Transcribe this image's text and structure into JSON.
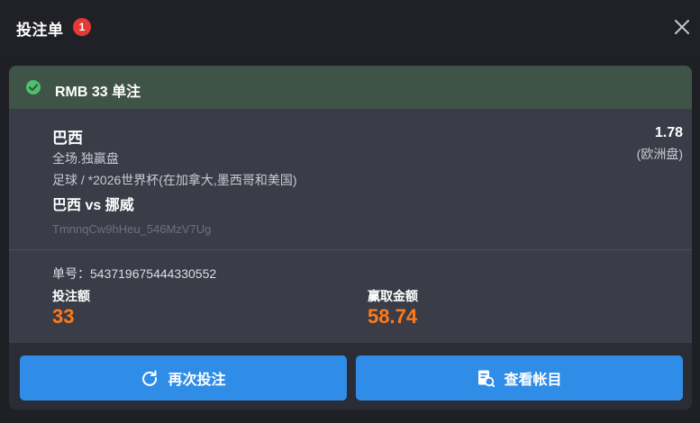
{
  "header": {
    "title": "投注单",
    "badge_count": "1",
    "close_icon": "close-icon"
  },
  "card": {
    "status_icon": "check-circle-icon",
    "status_color": "#3f5447",
    "title": "RMB 33 单注",
    "team": "巴西",
    "market": "全场.独赢盘",
    "league": "足球 / *2026世界杯(在加拿大,墨西哥和美国)",
    "match": "巴西 vs 挪威",
    "token": "TmnnqCw9hHeu_546MzV7Ug",
    "odds": "1.78",
    "odds_type": "(欧洲盘)",
    "order_label": "单号：543719675444330552",
    "stake_label": "投注额",
    "stake_value": "33",
    "win_label": "赢取金额",
    "win_value": "58.74",
    "accent_color": "#ff7a1a"
  },
  "buttons": {
    "rebet": {
      "label": "再次投注",
      "icon": "refresh-icon"
    },
    "account": {
      "label": "查看帐目",
      "icon": "document-search-icon"
    },
    "color": "#2f8de8"
  }
}
